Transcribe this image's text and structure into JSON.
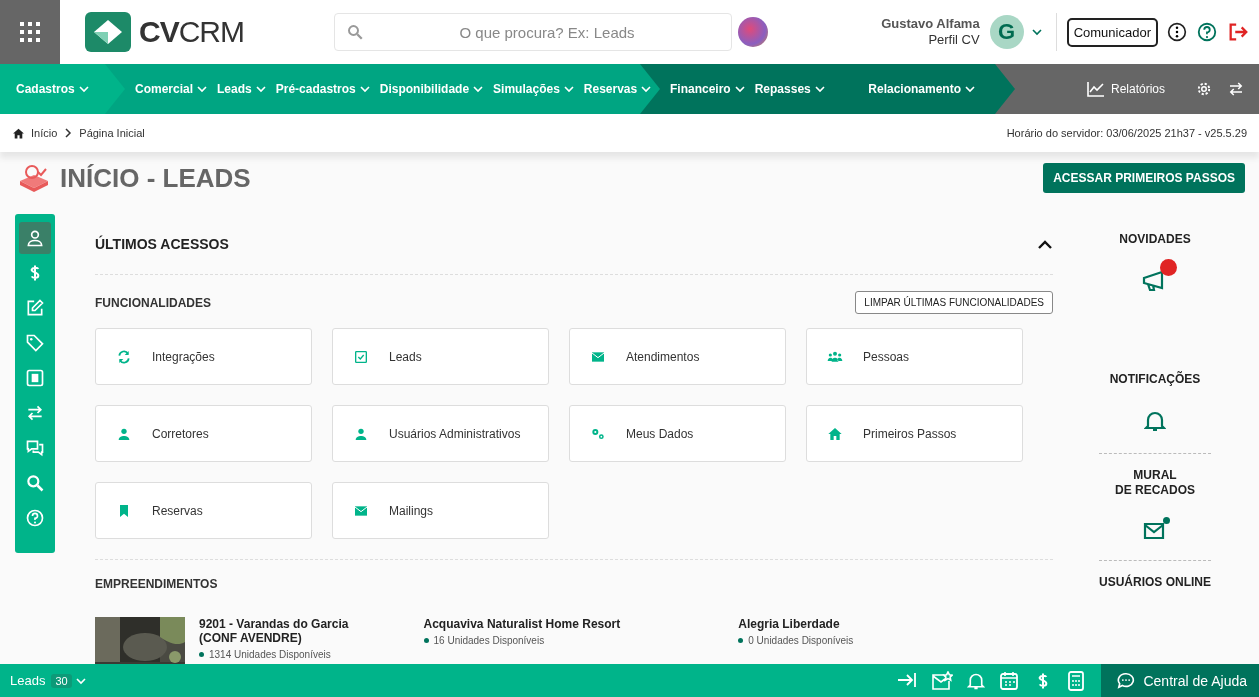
{
  "header": {
    "logo": "**CV**CRM",
    "search": {
      "placeholder": "O que procura? Ex: Leads"
    },
    "user": {
      "name": "Gustavo Alfama",
      "profile": "Perfil CV",
      "initial": "G"
    },
    "communicator": "Comunicador"
  },
  "nav_groups": [
    {
      "items": [
        {
          "label": "Cadastros"
        }
      ]
    },
    {
      "items": [
        {
          "label": "Comercial"
        },
        {
          "label": "Leads"
        },
        {
          "label": "Pré-cadastros"
        },
        {
          "label": "Disponibilidade"
        },
        {
          "label": "Simulações"
        },
        {
          "label": "Reservas"
        }
      ]
    },
    {
      "items": [
        {
          "label": "Financeiro"
        },
        {
          "label": "Repasses"
        },
        {
          "label": "Relacionamento"
        }
      ]
    }
  ],
  "reports": "Relatórios",
  "breadcrumb": [
    "Início",
    "Página Inicial"
  ],
  "server_time": "Horário do servidor: 03/06/2025 21h37 - v25.5.29",
  "page_title": "INÍCIO - LEADS",
  "primary_button": "ACESSAR PRIMEIROS PASSOS",
  "side_tools": [
    {
      "selected": true
    },
    {
      "selected": false
    },
    {
      "selected": false
    },
    {
      "selected": false
    },
    {
      "selected": false
    },
    {
      "selected": false
    },
    {
      "selected": false
    },
    {
      "selected": false
    },
    {
      "selected": false
    }
  ],
  "recent": {
    "title": "ÚLTIMOS ACESSOS",
    "expanded": true,
    "features_title": "FUNCIONALIDADES",
    "clear_button": "LIMPAR ÚLTIMAS FUNCIONALIDADES",
    "features": [
      {
        "label": "Integrações"
      },
      {
        "label": "Leads"
      },
      {
        "label": "Atendimentos"
      },
      {
        "label": "Pessoas"
      },
      {
        "label": "Corretores"
      },
      {
        "label": "Usuários Administrativos"
      },
      {
        "label": "Meus Dados"
      },
      {
        "label": "Primeiros Passos"
      },
      {
        "label": "Reservas"
      },
      {
        "label": "Mailings"
      }
    ],
    "projects_title": "EMPREENDIMENTOS",
    "projects": [
      {
        "name": "9201 - Varandas do Garcia (CONF AVENDRE)",
        "units": "1314 Unidades Disponíveis",
        "kind": "picture"
      },
      {
        "name": "Acquaviva Naturalist Home Resort",
        "units": "16 Unidades Disponíveis"
      },
      {
        "name": "Alegria Liberdade",
        "units": "0 Unidades Disponíveis"
      }
    ]
  },
  "right_panel": [
    {
      "title": "NOVIDADES",
      "badge": true
    },
    {
      "title": "NOTIFICAÇÕES",
      "badge": false
    },
    {
      "title": "MURAL\nDE RECADOS",
      "badge": true
    },
    {
      "title": "USUÁRIOS ONLINE"
    }
  ],
  "footer": {
    "module": "Leads",
    "count": "30",
    "help": "Central de Ajuda"
  }
}
